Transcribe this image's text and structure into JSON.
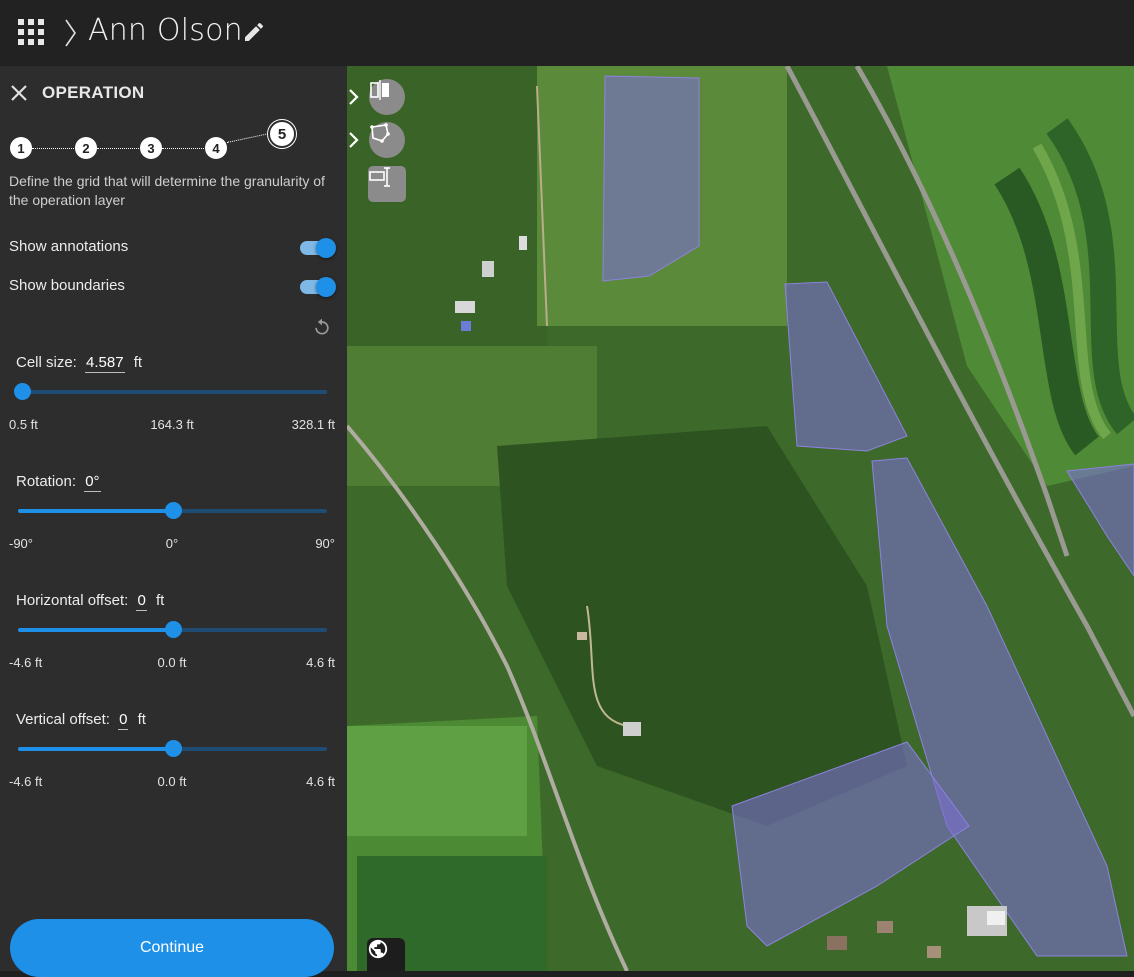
{
  "header": {
    "title": "Ann Olson",
    "icons": [
      "apps-grid-icon",
      "chevron-right-icon",
      "edit-pencil-icon"
    ]
  },
  "sidebar": {
    "heading": "OPERATION",
    "steps": [
      {
        "label": "1"
      },
      {
        "label": "2"
      },
      {
        "label": "3"
      },
      {
        "label": "4"
      },
      {
        "label": "5",
        "current": true
      }
    ],
    "description": "Define the grid that will determine the granularity of the operation layer",
    "toggles": [
      {
        "label": "Show annotations",
        "on": true
      },
      {
        "label": "Show boundaries",
        "on": true
      }
    ],
    "sliders": [
      {
        "label": "Cell size:",
        "value": "4.587",
        "unit": "ft",
        "min": "0.5 ft",
        "mid": "164.3 ft",
        "max": "328.1 ft",
        "fraction": 0.013
      },
      {
        "label": "Rotation:",
        "value": "0°",
        "unit": "",
        "min": "-90°",
        "mid": "0°",
        "max": "90°",
        "fraction": 0.5
      },
      {
        "label": "Horizontal offset:",
        "value": "0",
        "unit": "ft",
        "min": "-4.6 ft",
        "mid": "0.0 ft",
        "max": "4.6 ft",
        "fraction": 0.5
      },
      {
        "label": "Vertical offset:",
        "value": "0",
        "unit": "ft",
        "min": "-4.6 ft",
        "mid": "0.0 ft",
        "max": "4.6 ft",
        "fraction": 0.5
      }
    ],
    "continue_label": "Continue"
  },
  "colors": {
    "accent": "#1e90e8",
    "panel": "#2d2d2d",
    "topbar": "#222222",
    "field_overlay": "#7b6fd0"
  },
  "map": {
    "tools": [
      "split-field-icon",
      "edit-boundary-icon",
      "measure-tool-icon"
    ],
    "basemap_button": "globe-icon"
  }
}
